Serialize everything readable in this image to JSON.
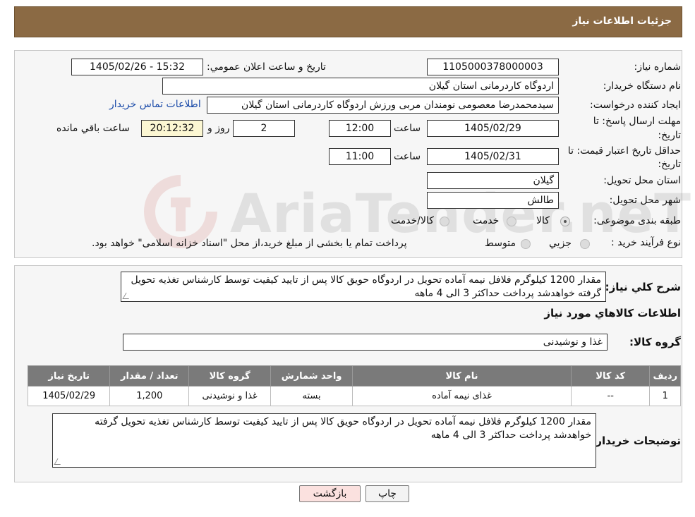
{
  "header": {
    "title": "جزئیات اطلاعات نیاز"
  },
  "need": {
    "need_number_label": "شماره نیاز:",
    "need_number": "1105000378000003",
    "announce_label": "تاریخ و ساعت اعلان عمومي:",
    "announce_value": "1405/02/26 - 15:32",
    "buyer_org_label": "نام دستگاه خریدار:",
    "buyer_org": "اردوگاه کاردرمانی استان گیلان",
    "creator_label": "ایجاد کننده درخواست:",
    "creator": "سیدمحمدرضا معصومی نومندان مربی ورزش اردوگاه کاردرمانی استان گیلان",
    "contact_link": "اطلاعات تماس خریدار",
    "deadline_label_1": "مهلت ارسال پاسخ: تا",
    "deadline_label_2": "تاریخ:",
    "deadline_date": "1405/02/29",
    "time_label": "ساعت",
    "deadline_time": "12:00",
    "days": "2",
    "days_label": "روز و",
    "remaining_time": "20:12:32",
    "remaining_label": "ساعت باقي مانده",
    "validity_label_1": "حداقل تاریخ اعتبار قیمت: تا",
    "validity_label_2": "تاریخ:",
    "validity_date": "1405/02/31",
    "validity_time": "11:00",
    "province_label": "استان محل تحویل:",
    "province": "گیلان",
    "city_label": "شهر محل تحویل:",
    "city": "طالش",
    "category_label": "طبقه بندی موضوعی:",
    "category_options": [
      "کالا",
      "خدمت",
      "کالا/خدمت"
    ],
    "process_label": "نوع فرآیند خرید :",
    "process_options": [
      "جزیي",
      "متوسط"
    ],
    "process_note": "پرداخت تمام یا بخشی از مبلغ خرید،از محل \"اسناد خزانه اسلامی\" خواهد بود."
  },
  "summary": {
    "label": "شرح کلي نياز:",
    "text": "مقدار 1200 کیلوگرم فلافل نیمه آماده تحویل در اردوگاه حویق کالا پس از تایید کیفیت توسط کارشناس تغذیه تحویل گرفته خواهدشد پرداخت حداکثر 3 الی 4 ماهه"
  },
  "goods": {
    "section_title": "اطلاعات کالاهاي مورد نياز",
    "group_label": "گروه کالا:",
    "group_value": "غذا و نوشیدنی",
    "columns": [
      "رديف",
      "کد کالا",
      "نام کالا",
      "واحد شمارش",
      "گروه کالا",
      "تعداد / مقدار",
      "تاريخ نياز"
    ],
    "rows": [
      [
        "1",
        "--",
        "غذای نیمه آماده",
        "بسته",
        "غذا و نوشیدنی",
        "1,200",
        "1405/02/29"
      ]
    ]
  },
  "buyer_notes": {
    "label": "توضیحات خریدار:",
    "text": "مقدار 1200 کیلوگرم فلافل نیمه آماده تحویل در اردوگاه حویق کالا پس از تایید کیفیت توسط کارشناس تغذیه تحویل گرفته خواهدشد پرداخت حداکثر 3 الی 4 ماهه"
  },
  "buttons": {
    "print": "چاپ",
    "back": "بازگشت"
  },
  "watermark": {
    "text": "AriaTender.neT"
  },
  "colors": {
    "header_bg": "#8b6a44",
    "table_header_bg": "#7a7a7a",
    "link": "#1a4aa8",
    "remaining_bg": "#fcf7d3",
    "back_btn_bg": "#fbe1df"
  }
}
